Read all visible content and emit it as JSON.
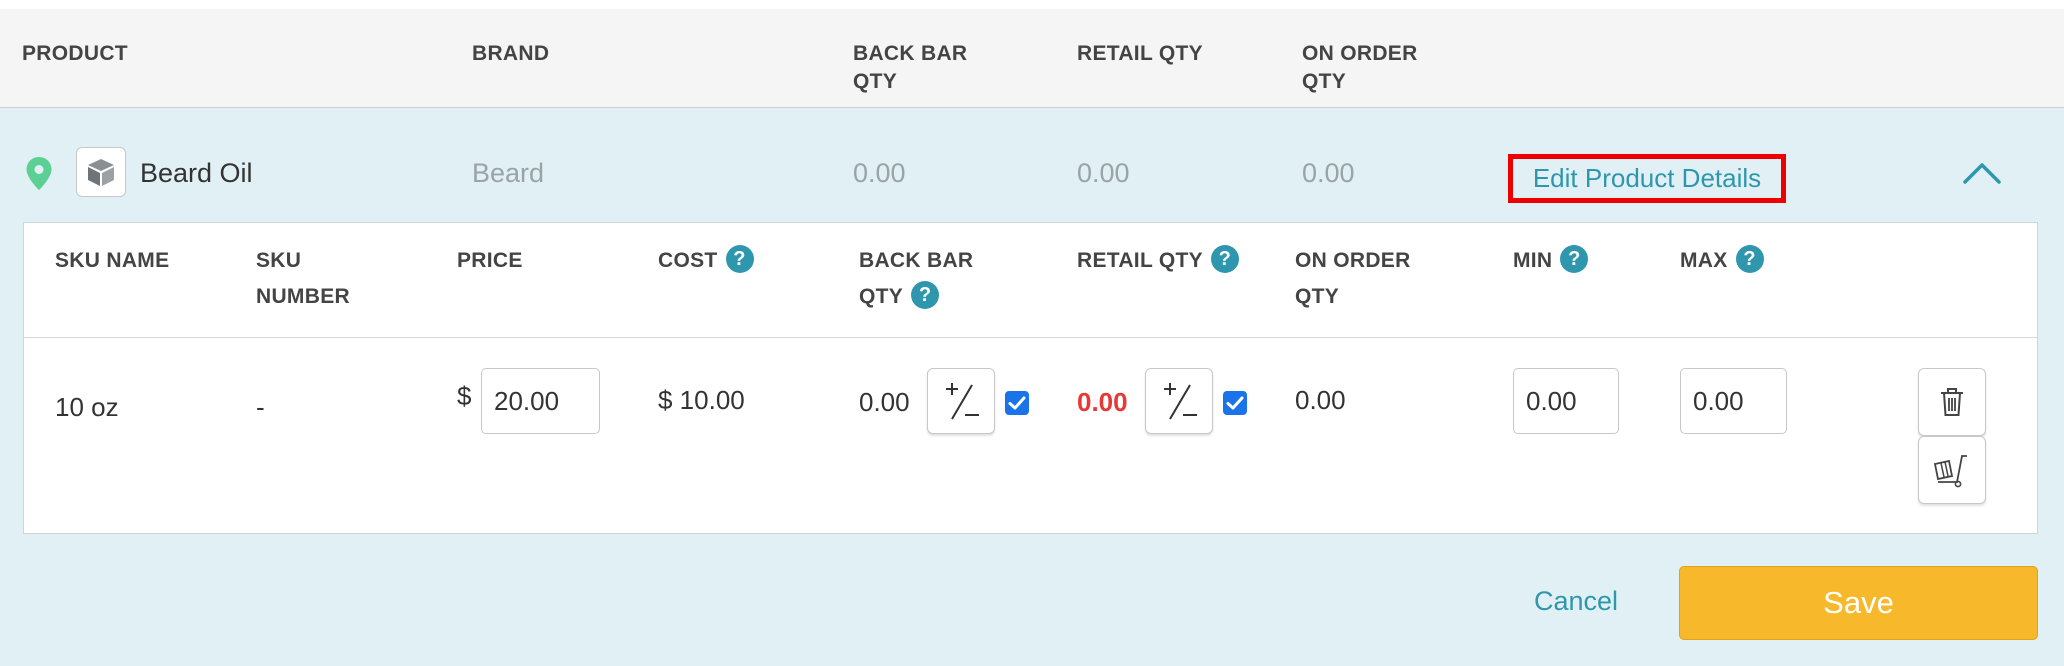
{
  "header": {
    "columns": {
      "product": "PRODUCT",
      "brand": "BRAND",
      "back_bar_qty_line1": "BACK BAR",
      "back_bar_qty_line2": "QTY",
      "retail_qty": "RETAIL QTY",
      "on_order_qty_line1": "ON ORDER",
      "on_order_qty_line2": "QTY"
    }
  },
  "product": {
    "name": "Beard Oil",
    "brand": "Beard",
    "back_bar_qty": "0.00",
    "retail_qty": "0.00",
    "on_order_qty": "0.00",
    "edit_link": "Edit Product Details",
    "pin_color": "#5ccf95",
    "icons": [
      "location-pin-icon",
      "product-box-icon",
      "chevron-up-icon"
    ]
  },
  "sku_table": {
    "columns": {
      "sku_name": "SKU NAME",
      "sku_number_line1": "SKU",
      "sku_number_line2": "NUMBER",
      "price": "PRICE",
      "cost": "COST",
      "back_bar_qty_line1": "BACK BAR",
      "back_bar_qty_line2": "QTY",
      "retail_qty": "RETAIL QTY",
      "on_order_qty_line1": "ON ORDER",
      "on_order_qty_line2": "QTY",
      "min": "MIN",
      "max": "MAX"
    },
    "help_glyph": "?",
    "rows": [
      {
        "sku_name": "10 oz",
        "sku_number": "-",
        "price_currency": "$",
        "price": "20.00",
        "cost": "$ 10.00",
        "back_bar_qty": "0.00",
        "back_bar_checked": true,
        "retail_qty": "0.00",
        "retail_qty_color": "#e53935",
        "retail_checked": true,
        "on_order_qty": "0.00",
        "min": "0.00",
        "max": "0.00",
        "icons": [
          "plus-minus-icon",
          "delete-trash-icon",
          "cart-dolly-icon"
        ]
      }
    ]
  },
  "footer": {
    "cancel": "Cancel",
    "save": "Save"
  },
  "colors": {
    "accent": "#2f97ad",
    "save": "#f7b92b",
    "highlight_border": "#ee0000",
    "panel_bg": "#e1f0f4"
  }
}
